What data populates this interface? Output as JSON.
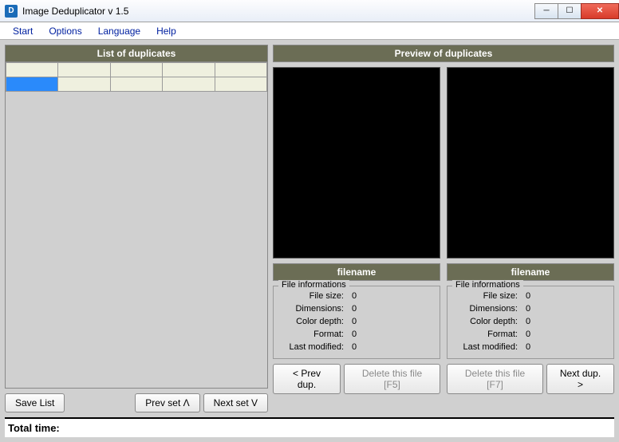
{
  "window": {
    "title": "Image Deduplicator v 1.5",
    "icon_letter": "D"
  },
  "menu": {
    "start": "Start",
    "options": "Options",
    "language": "Language",
    "help": "Help"
  },
  "left_panel": {
    "header": "List of duplicates",
    "btn_save": "Save List",
    "btn_prev_set": "Prev set Λ",
    "btn_next_set": "Next set V"
  },
  "right_panel": {
    "header": "Preview of duplicates",
    "filename_label": "filename",
    "fileinfo_legend": "File informations",
    "labels": {
      "size": "File size:",
      "dims": "Dimensions:",
      "depth": "Color depth:",
      "format": "Format:",
      "modified": "Last modified:"
    },
    "left_values": {
      "size": "0",
      "dims": "0",
      "depth": "0",
      "format": "0",
      "modified": "0"
    },
    "right_values": {
      "size": "0",
      "dims": "0",
      "depth": "0",
      "format": "0",
      "modified": "0"
    },
    "btn_prev_dup": "< Prev dup.",
    "btn_delete_f5": "Delete this file [F5]",
    "btn_delete_f7": "Delete this file [F7]",
    "btn_next_dup": "Next dup. >"
  },
  "footer": {
    "total_time": "Total time:"
  }
}
